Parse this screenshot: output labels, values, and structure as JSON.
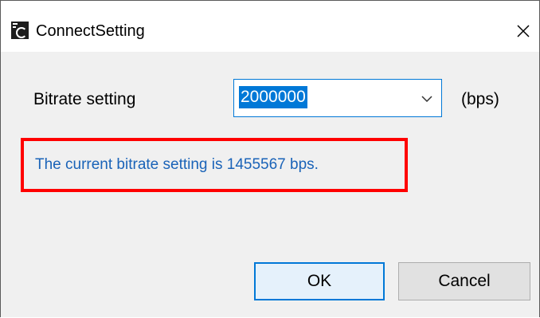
{
  "window": {
    "title": "ConnectSetting",
    "close_icon": "close-icon",
    "app_icon": "app-icon"
  },
  "form": {
    "bitrate_label": "Bitrate setting",
    "bitrate_value": "2000000",
    "unit_label": "(bps)",
    "dropdown_icon": "chevron-down-icon"
  },
  "message": {
    "text": "The current bitrate setting is 1455567 bps.",
    "text_color": "#1a63b8",
    "highlight_color": "#ff0000"
  },
  "buttons": {
    "ok_label": "OK",
    "cancel_label": "Cancel"
  },
  "colors": {
    "accent": "#0078d7",
    "dialog_background": "#f0f0f0"
  }
}
